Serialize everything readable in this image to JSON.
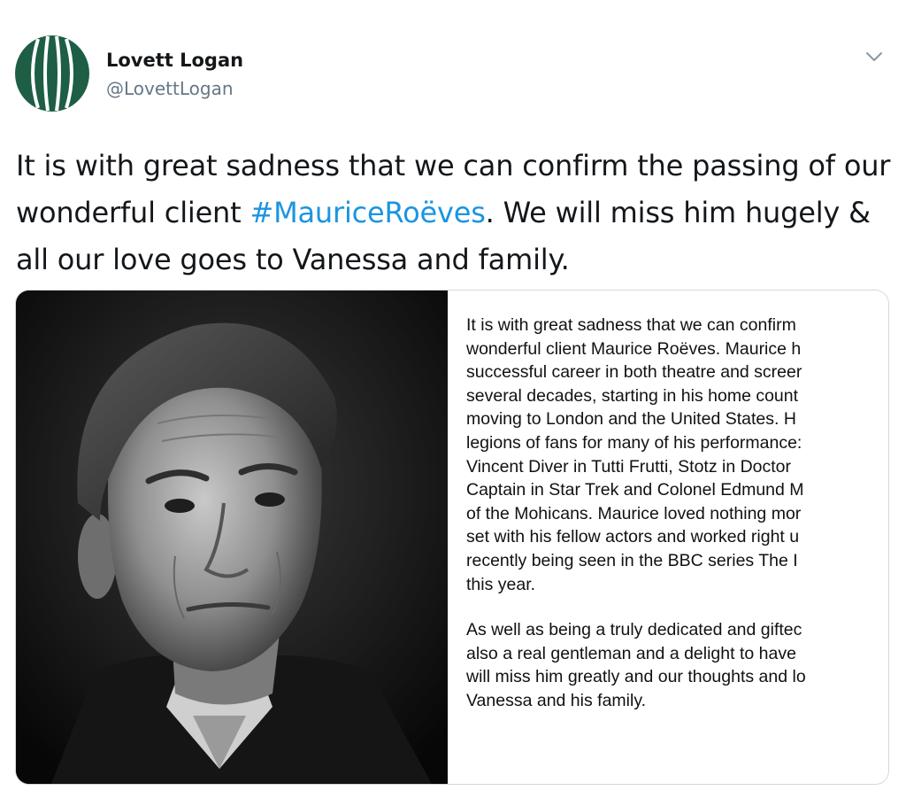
{
  "author": {
    "name": "Lovett Logan",
    "handle": "@LovettLogan",
    "avatar_icon": "lovett-logan-logo",
    "brand_color": "#1d5e45"
  },
  "tweet": {
    "text_before": "It is with great sadness that we can confirm the passing of our wonderful client ",
    "hashtag": "#MauriceRoëves",
    "text_after": ". We will miss him hugely & all our love goes to Vanessa and family.",
    "hashtag_color": "#1b95e0"
  },
  "menu": {
    "icon": "chevron-down-icon"
  },
  "media": {
    "photo_subject": "black-and-white-portrait",
    "statement": {
      "p1": [
        "It is with great sadness that we can confirm",
        "wonderful client Maurice Roëves. Maurice h",
        "successful career in both theatre and screer",
        "several decades, starting in his home count",
        "moving to London and the United States. H",
        "legions of fans for many of his performance:",
        "Vincent Diver in Tutti Frutti, Stotz in Doctor",
        "Captain in Star Trek and Colonel Edmund M",
        "of the Mohicans. Maurice loved nothing mor",
        "set with his fellow actors and worked right u",
        "recently being seen in the BBC series The I",
        "this year."
      ],
      "p2": [
        "As well as being a truly dedicated and giftec",
        "also a real gentleman and a delight to have",
        "will miss him greatly and our thoughts and lo",
        "Vanessa and his family."
      ]
    }
  }
}
